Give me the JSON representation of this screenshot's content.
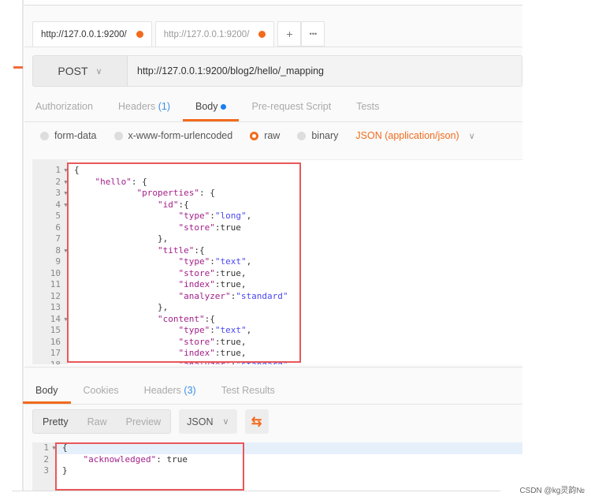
{
  "tabs": [
    {
      "label": "http://127.0.0.1:9200/",
      "active": true
    },
    {
      "label": "http://127.0.0.1:9200/",
      "active": false
    }
  ],
  "tab_actions": {
    "add": "+",
    "more": "•••"
  },
  "request": {
    "method": "POST",
    "url": "http://127.0.0.1:9200/blog2/hello/_mapping"
  },
  "request_tabs": {
    "authorization": "Authorization",
    "headers": "Headers",
    "headers_count": "(1)",
    "body": "Body",
    "prerequest": "Pre-request Script",
    "tests": "Tests"
  },
  "body_modes": {
    "form_data": "form-data",
    "urlencoded": "x-www-form-urlencoded",
    "raw": "raw",
    "binary": "binary",
    "selected": "raw",
    "content_type": "JSON (application/json)"
  },
  "request_body": [
    "{",
    "    \"hello\": {",
    "            \"properties\": {",
    "                \"id\":{",
    "                    \"type\":\"long\",",
    "                    \"store\":true",
    "                },",
    "                \"title\":{",
    "                    \"type\":\"text\",",
    "                    \"store\":true,",
    "                    \"index\":true,",
    "                    \"analyzer\":\"standard\"",
    "                },",
    "                \"content\":{",
    "                    \"type\":\"text\",",
    "                    \"store\":true,",
    "                    \"index\":true,",
    "                    \"analyzer\":\"standard\""
  ],
  "foldable_lines": [
    1,
    2,
    3,
    4,
    8,
    14
  ],
  "response_tabs": {
    "body": "Body",
    "cookies": "Cookies",
    "headers": "Headers",
    "headers_count": "(3)",
    "test_results": "Test Results"
  },
  "response_toolbar": {
    "pretty": "Pretty",
    "raw": "Raw",
    "preview": "Preview",
    "format": "JSON"
  },
  "response_body": [
    "{",
    "    \"acknowledged\": true",
    "}"
  ],
  "watermark": "CSDN @kg灵韵№",
  "colors": {
    "accent": "#f26b1d",
    "highlight_box": "#e8585a",
    "key": "#a3218a",
    "string": "#4b48f2"
  }
}
